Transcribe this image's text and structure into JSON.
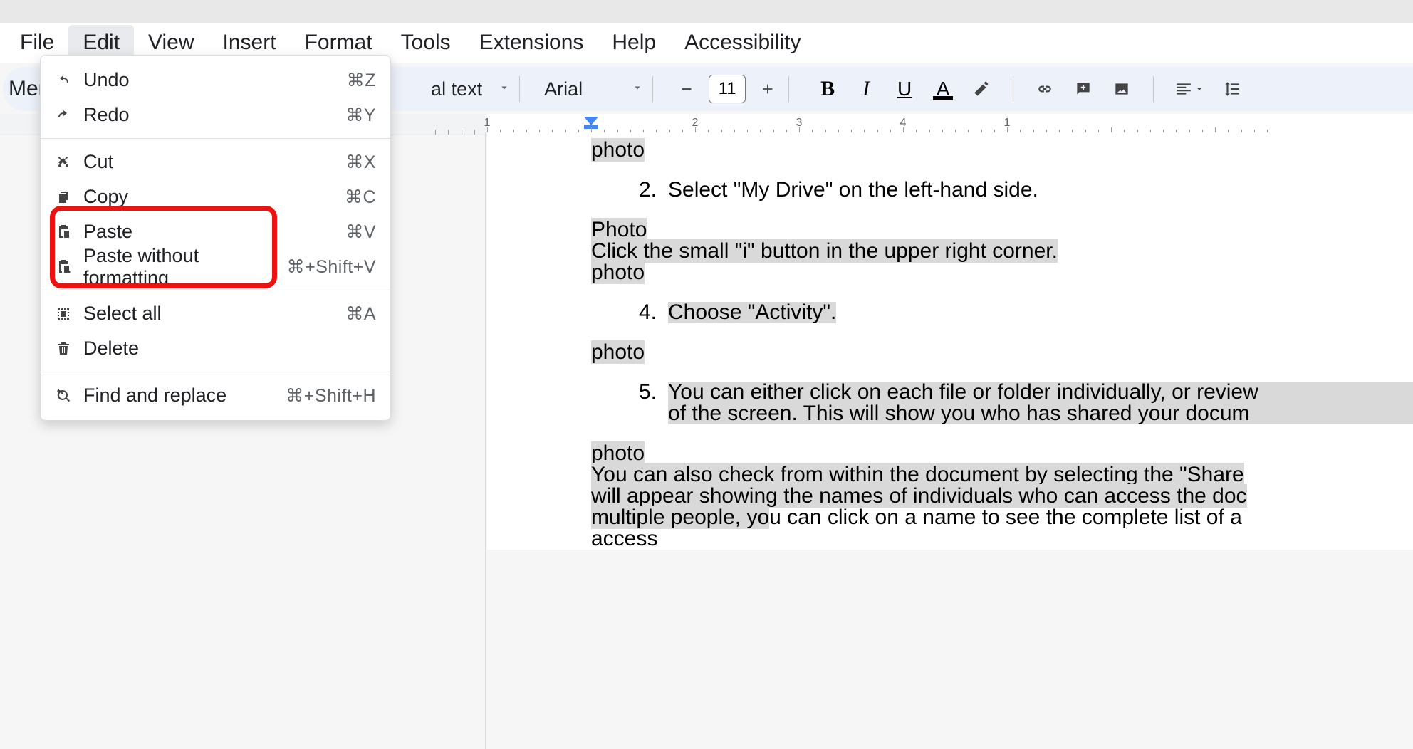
{
  "menu": {
    "file": "File",
    "edit_label": "Edit",
    "view": "View",
    "insert": "Insert",
    "format": "Format",
    "tools": "Tools",
    "extensions": "Extensions",
    "help": "Help",
    "accessibility": "Accessibility"
  },
  "edit_menu": {
    "undo": "Undo",
    "undo_kbd": "⌘Z",
    "redo": "Redo",
    "redo_kbd": "⌘Y",
    "cut": "Cut",
    "cut_kbd": "⌘X",
    "copy": "Copy",
    "copy_kbd": "⌘C",
    "paste": "Paste",
    "paste_kbd": "⌘V",
    "paste_wf": "Paste without formatting",
    "paste_wf_kbd": "⌘+Shift+V",
    "select_all": "Select all",
    "select_all_kbd": "⌘A",
    "delete": "Delete",
    "find_replace": "Find and replace",
    "find_replace_kbd": "⌘+Shift+H"
  },
  "toolbar": {
    "menus_label": "Menu",
    "style": "al text",
    "font": "Arial",
    "font_size": "11"
  },
  "ruler": {
    "n1": "1",
    "n2": "2",
    "n3": "3",
    "n4": "4"
  },
  "doc": {
    "p_photo1": "photo",
    "li2_num": "2.",
    "li2": "Select \"My Drive\" on the left-hand side.",
    "p_Photo": "Photo",
    "p_click_i": "Click the small \"i\" button in the upper right corner.",
    "p_photo2": "photo",
    "li4_num": "4.",
    "li4": "Choose \"Activity\".",
    "p_photo3": "photo",
    "li5_num": "5.",
    "li5a": "You can either click on each file or folder individually, or review",
    "li5b": "of the screen. This will show you who has shared your docum",
    "p_photo4": "photo",
    "p_share1": "You can also check from within the document by selecting the \"Share",
    "p_share2": "will appear showing the names of individuals who can access the doc",
    "p_share3": "multiple people, yo",
    "p_share3b": "u can click on a name to see the complete list of a",
    "p_access": "access"
  }
}
